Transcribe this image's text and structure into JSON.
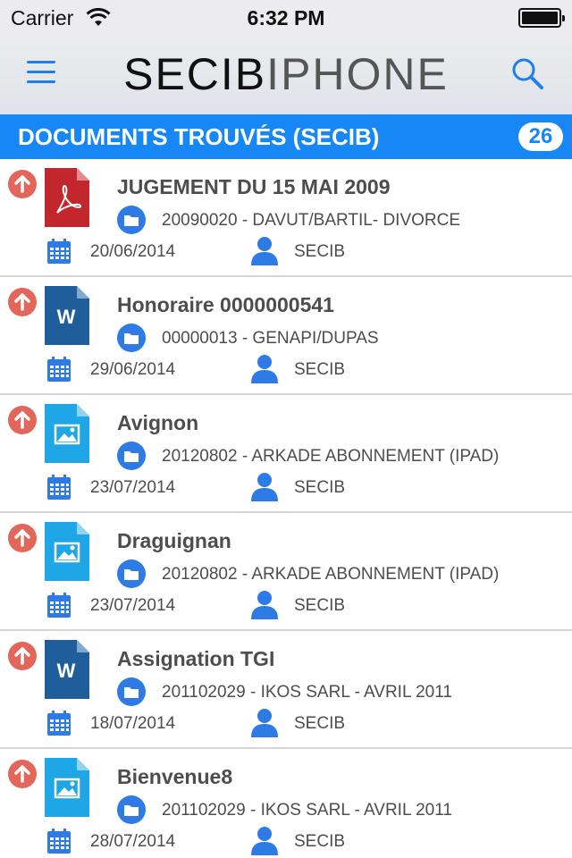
{
  "status_bar": {
    "carrier": "Carrier",
    "time": "6:32 PM"
  },
  "nav": {
    "menu_icon": "hamburger-menu-icon",
    "logo_part1": "SECIB",
    "logo_part2": "IPHONE",
    "search_icon": "search-icon",
    "accent_color": "#1e7ff0"
  },
  "section": {
    "title": "DOCUMENTS TROUVÉS (SECIB)",
    "count": "26",
    "color": "#1787f5"
  },
  "documents": [
    {
      "type": "pdf",
      "title": "JUGEMENT DU 15 MAI 2009",
      "folder": "20090020 - DAVUT/BARTIL- DIVORCE",
      "date": "20/06/2014",
      "user": "SECIB"
    },
    {
      "type": "word",
      "title": "Honoraire 0000000541",
      "folder": "00000013 - GENAPI/DUPAS",
      "date": "29/06/2014",
      "user": "SECIB"
    },
    {
      "type": "image",
      "title": "Avignon",
      "folder": "20120802 - ARKADE ABONNEMENT (IPAD)",
      "date": "23/07/2014",
      "user": "SECIB"
    },
    {
      "type": "image",
      "title": "Draguignan",
      "folder": "20120802 - ARKADE ABONNEMENT (IPAD)",
      "date": "23/07/2014",
      "user": "SECIB"
    },
    {
      "type": "word",
      "title": "Assignation TGI",
      "folder": "201102029 - IKOS SARL - AVRIL 2011",
      "date": "18/07/2014",
      "user": "SECIB"
    },
    {
      "type": "image",
      "title": "Bienvenue8",
      "folder": "201102029 - IKOS SARL - AVRIL 2011",
      "date": "28/07/2014",
      "user": "SECIB"
    }
  ]
}
